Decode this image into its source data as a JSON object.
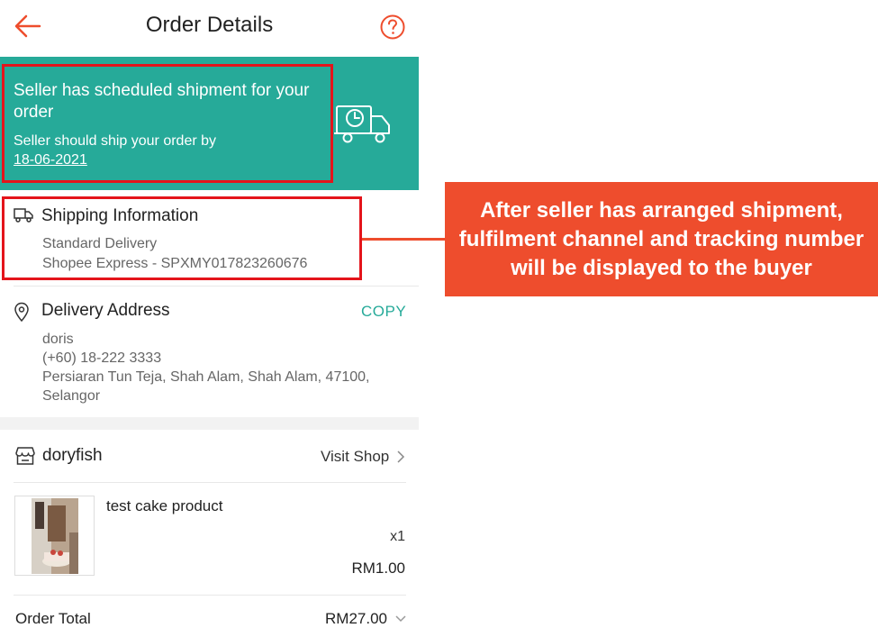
{
  "header": {
    "title": "Order Details"
  },
  "status": {
    "title": "Seller has scheduled shipment for your order",
    "subtitle": "Seller should ship your order by",
    "date": "18-06-2021"
  },
  "shipping": {
    "title": "Shipping Information",
    "service": "Standard Delivery",
    "tracking": "Shopee Express - SPXMY017823260676"
  },
  "address": {
    "title": "Delivery Address",
    "copy_label": "COPY",
    "name": "doris",
    "phone": "(+60) 18-222 3333",
    "line1": "Persiaran Tun Teja, Shah Alam, Shah Alam, 47100,",
    "line2": "Selangor"
  },
  "shop": {
    "name": "doryfish",
    "visit_label": "Visit Shop"
  },
  "product": {
    "name": "test cake product",
    "qty": "x1",
    "price": "RM1.00"
  },
  "total": {
    "label": "Order Total",
    "value": "RM27.00"
  },
  "callout": {
    "text": "After seller has arranged shipment, fulfilment channel and tracking number will be displayed to the buyer"
  },
  "colors": {
    "accent": "#ee4d2d",
    "teal": "#26aa99",
    "highlight_border": "#e4141b"
  },
  "icons": [
    "back-arrow-icon",
    "help-icon",
    "truck-clock-icon",
    "truck-icon",
    "location-pin-icon",
    "shop-icon",
    "chevron-right-icon",
    "chevron-down-icon"
  ]
}
